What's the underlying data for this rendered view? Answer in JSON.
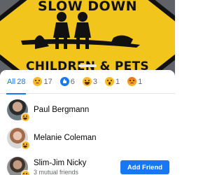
{
  "photo": {
    "sign_top_text": "SLOW DOWN",
    "sign_bottom_text": "CHILDREN & PETS"
  },
  "reactions": {
    "tabs": [
      {
        "icon": "all",
        "label": "All",
        "count": "28",
        "active": true
      },
      {
        "icon": "sad-icon",
        "count": "17"
      },
      {
        "icon": "like-icon",
        "count": "6"
      },
      {
        "icon": "haha-icon",
        "count": "3"
      },
      {
        "icon": "wow-icon",
        "count": "1"
      },
      {
        "icon": "angry-icon",
        "count": "1"
      }
    ]
  },
  "people": [
    {
      "name": "Paul Bergmann",
      "badge": "haha-icon"
    },
    {
      "name": "Melanie Coleman",
      "badge": "haha-icon"
    },
    {
      "name": "Slim-Jim Nicky",
      "subtitle": "3 mutual friends",
      "badge": "haha-icon",
      "button": "Add Friend"
    }
  ],
  "colors": {
    "accent": "#1877f2",
    "reaction_yellow": "#f7b928",
    "sign_yellow": "#f2c51c"
  }
}
